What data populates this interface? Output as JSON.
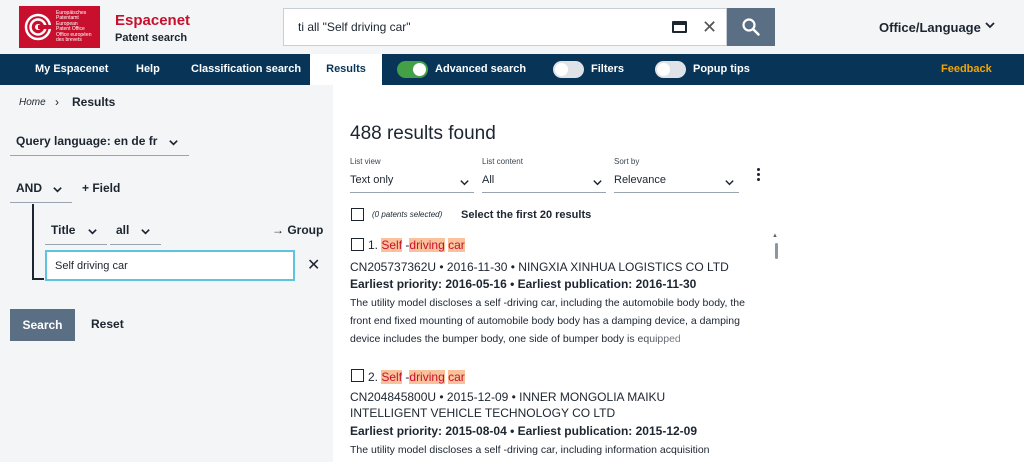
{
  "header": {
    "logo_lines": [
      "Europäisches",
      "Patentamt",
      "European",
      "Patent Office",
      "Office européen",
      "des brevets"
    ],
    "brand_name": "Espacenet",
    "brand_sub": "Patent search",
    "search_value": "ti all \"Self driving car\"",
    "office_language": "Office/Language"
  },
  "nav": {
    "my_espacenet": "My Espacenet",
    "help": "Help",
    "classification_search": "Classification search",
    "results": "Results",
    "advanced_search": "Advanced search",
    "filters": "Filters",
    "popup_tips": "Popup tips",
    "feedback": "Feedback",
    "toggles": {
      "advanced_search": true,
      "filters": false,
      "popup_tips": false
    }
  },
  "breadcrumb": {
    "home": "Home",
    "current": "Results"
  },
  "query": {
    "language_label": "Query language: en de fr",
    "operator": "AND",
    "add_field": "+ Field",
    "field": "Title",
    "match": "all",
    "group": "→ Group",
    "field_value": "Self driving car",
    "search_button": "Search",
    "reset_button": "Reset"
  },
  "results": {
    "count_text": "488 results found",
    "list_view": {
      "label": "List view",
      "value": "Text only"
    },
    "list_content": {
      "label": "List content",
      "value": "All"
    },
    "sort_by": {
      "label": "Sort by",
      "value": "Relevance"
    },
    "selected_note": "(0 patents selected)",
    "select_first": "Select the first 20 results",
    "items": [
      {
        "num": "1.",
        "w1": "Self",
        "sep": " -",
        "w2": "driving",
        "w3": "car",
        "meta": "CN205737362U • 2016-11-30 • NINGXIA XINHUA LOGISTICS CO LTD",
        "priority": "Earliest priority: 2016-05-16 • Earliest publication: 2016-11-30",
        "abstract": "The utility model discloses a self -driving car, including the automobile body body, the front end fixed mounting of automobile body body has a damping device, a damping device includes the bumper body, one side of bumper body is equipped"
      },
      {
        "num": "2.",
        "w1": "Self",
        "sep": " -",
        "w2": "driving",
        "w3": "car",
        "meta": "CN204845800U • 2015-12-09 • INNER MONGOLIA MAIKU INTELLIGENT VEHICLE TECHNOLOGY CO LTD",
        "priority": "Earliest priority: 2015-08-04 • Earliest publication: 2015-12-09",
        "abstract": "The utility model discloses a self -driving car, including information acquisition"
      }
    ]
  },
  "colors": {
    "brand_red": "#c8102e",
    "nav_bg": "#083557",
    "highlight": "#f9c29a",
    "feedback": "#f5a400",
    "toggle_on": "#43a047"
  }
}
